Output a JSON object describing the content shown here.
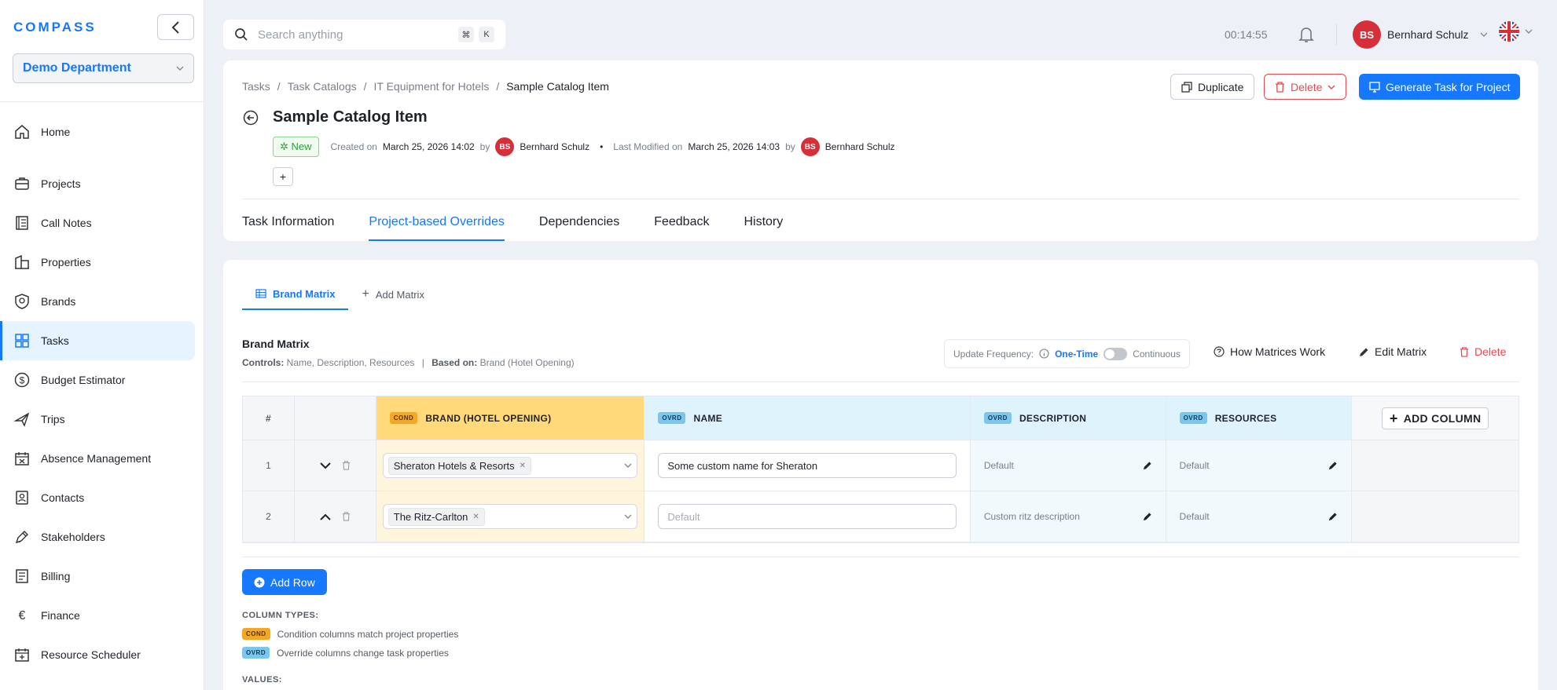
{
  "app": {
    "logo": "COMPASS",
    "department": "Demo Department"
  },
  "sidebar": {
    "items": [
      {
        "label": "Home",
        "icon": "home-icon"
      },
      {
        "label": "Projects",
        "icon": "briefcase-icon"
      },
      {
        "label": "Call Notes",
        "icon": "notes-icon"
      },
      {
        "label": "Properties",
        "icon": "building-icon"
      },
      {
        "label": "Brands",
        "icon": "brand-icon"
      },
      {
        "label": "Tasks",
        "icon": "grid-icon",
        "active": true
      },
      {
        "label": "Budget Estimator",
        "icon": "dollar-icon"
      },
      {
        "label": "Trips",
        "icon": "plane-icon"
      },
      {
        "label": "Absence Management",
        "icon": "calendar-icon"
      },
      {
        "label": "Contacts",
        "icon": "contacts-icon"
      },
      {
        "label": "Stakeholders",
        "icon": "pen-icon"
      },
      {
        "label": "Billing",
        "icon": "billing-icon"
      },
      {
        "label": "Finance",
        "icon": "euro-icon"
      },
      {
        "label": "Resource Scheduler",
        "icon": "scheduler-icon"
      }
    ]
  },
  "topbar": {
    "search_placeholder": "Search anything",
    "kbd1": "⌘",
    "kbd2": "K",
    "timer": "00:14:55",
    "user_initials": "BS",
    "user_name": "Bernhard Schulz"
  },
  "breadcrumb": [
    "Tasks",
    "Task Catalogs",
    "IT Equipment for Hotels",
    "Sample Catalog Item"
  ],
  "header": {
    "title": "Sample Catalog Item",
    "status": "New",
    "created_label": "Created on",
    "created_date": "March 25, 2026 14:02",
    "by": "by",
    "initials": "BS",
    "created_by": "Bernhard Schulz",
    "modified_label": "Last Modified on",
    "modified_date": "March 25, 2026 14:03",
    "modified_by": "Bernhard Schulz",
    "plus": "+",
    "duplicate": "Duplicate",
    "delete": "Delete",
    "generate": "Generate Task for Project"
  },
  "tabs": [
    "Task Information",
    "Project-based Overrides",
    "Dependencies",
    "Feedback",
    "History"
  ],
  "subtabs": {
    "brand_matrix": "Brand Matrix",
    "add_matrix": "Add Matrix"
  },
  "matrix": {
    "title": "Brand Matrix",
    "controls_label": "Controls:",
    "controls_value": "Name, Description, Resources",
    "based_on_label": "Based on:",
    "based_on_value": "Brand (Hotel Opening)",
    "freq_label": "Update Frequency:",
    "freq_on": "One-Time",
    "freq_off": "Continuous",
    "how": "How Matrices Work",
    "edit": "Edit Matrix",
    "delete": "Delete",
    "headers": {
      "num": "#",
      "brand": "BRAND (HOTEL OPENING)",
      "name": "NAME",
      "description": "DESCRIPTION",
      "resources": "RESOURCES",
      "add_column": "ADD COLUMN",
      "cond": "COND",
      "ovrd": "OVRD"
    },
    "rows": [
      {
        "num": "1",
        "brand": "Sheraton Hotels & Resorts",
        "name": "Some custom name for Sheraton",
        "name_placeholder": "",
        "description": "Default",
        "resources": "Default"
      },
      {
        "num": "2",
        "brand": "The Ritz-Carlton",
        "name": "",
        "name_placeholder": "Default",
        "description": "Custom ritz description",
        "resources": "Default"
      }
    ],
    "add_row": "Add Row"
  },
  "legend": {
    "heading": "COLUMN TYPES:",
    "cond_tag": "COND",
    "cond_text": "Condition columns match project properties",
    "ovrd_tag": "OVRD",
    "ovrd_text": "Override columns change task properties",
    "values_heading": "VALUES:"
  },
  "colors": {
    "accent": "#1677ff",
    "danger": "#e5484d",
    "cond": "#ffd97a",
    "ovrd": "#dff3fd"
  }
}
